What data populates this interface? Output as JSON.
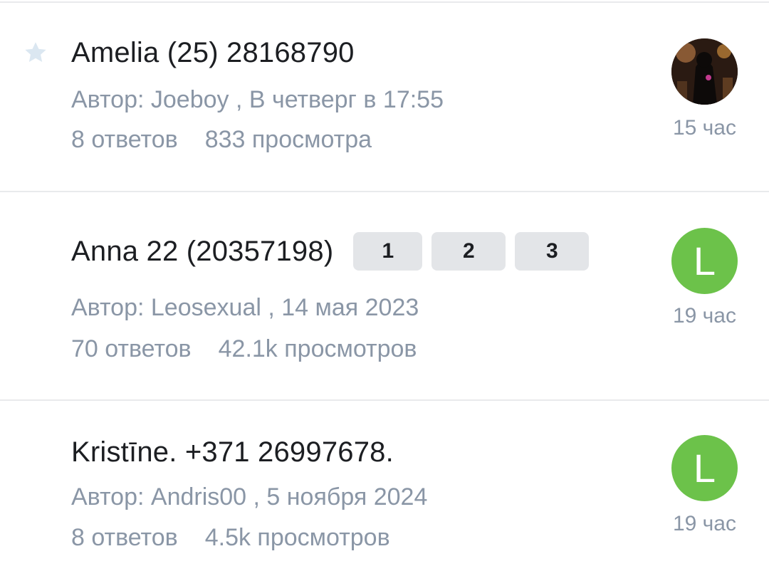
{
  "threads": [
    {
      "title": "Amelia (25) 28168790",
      "meta": "Автор: Joeboy , В четверг в 17:55",
      "replies": "8 ответов",
      "views": "833 просмотра",
      "time": "15 час",
      "avatar": {
        "type": "photo",
        "letter": ""
      },
      "starred": true,
      "pages": []
    },
    {
      "title": "Anna 22 (20357198)",
      "meta": "Автор: Leosexual , 14 мая 2023",
      "replies": "70 ответов",
      "views": "42.1k просмотров",
      "time": "19 час",
      "avatar": {
        "type": "letter",
        "letter": "L",
        "color": "#6cc24a"
      },
      "starred": false,
      "pages": [
        "1",
        "2",
        "3"
      ]
    },
    {
      "title": "Kristīne. +371 26997678.",
      "meta": "Автор: Andris00 , 5 ноября 2024",
      "replies": "8 ответов",
      "views": "4.5k просмотров",
      "time": "19 час",
      "avatar": {
        "type": "letter",
        "letter": "L",
        "color": "#6cc24a"
      },
      "starred": false,
      "pages": []
    }
  ],
  "colors": {
    "accent_green": "#6cc24a",
    "muted_text": "#8a96a6",
    "star": "#dbe7f1",
    "divider": "#e9eaec",
    "page_button_bg": "#e3e5e8"
  },
  "icons": {
    "star": "star-icon"
  }
}
